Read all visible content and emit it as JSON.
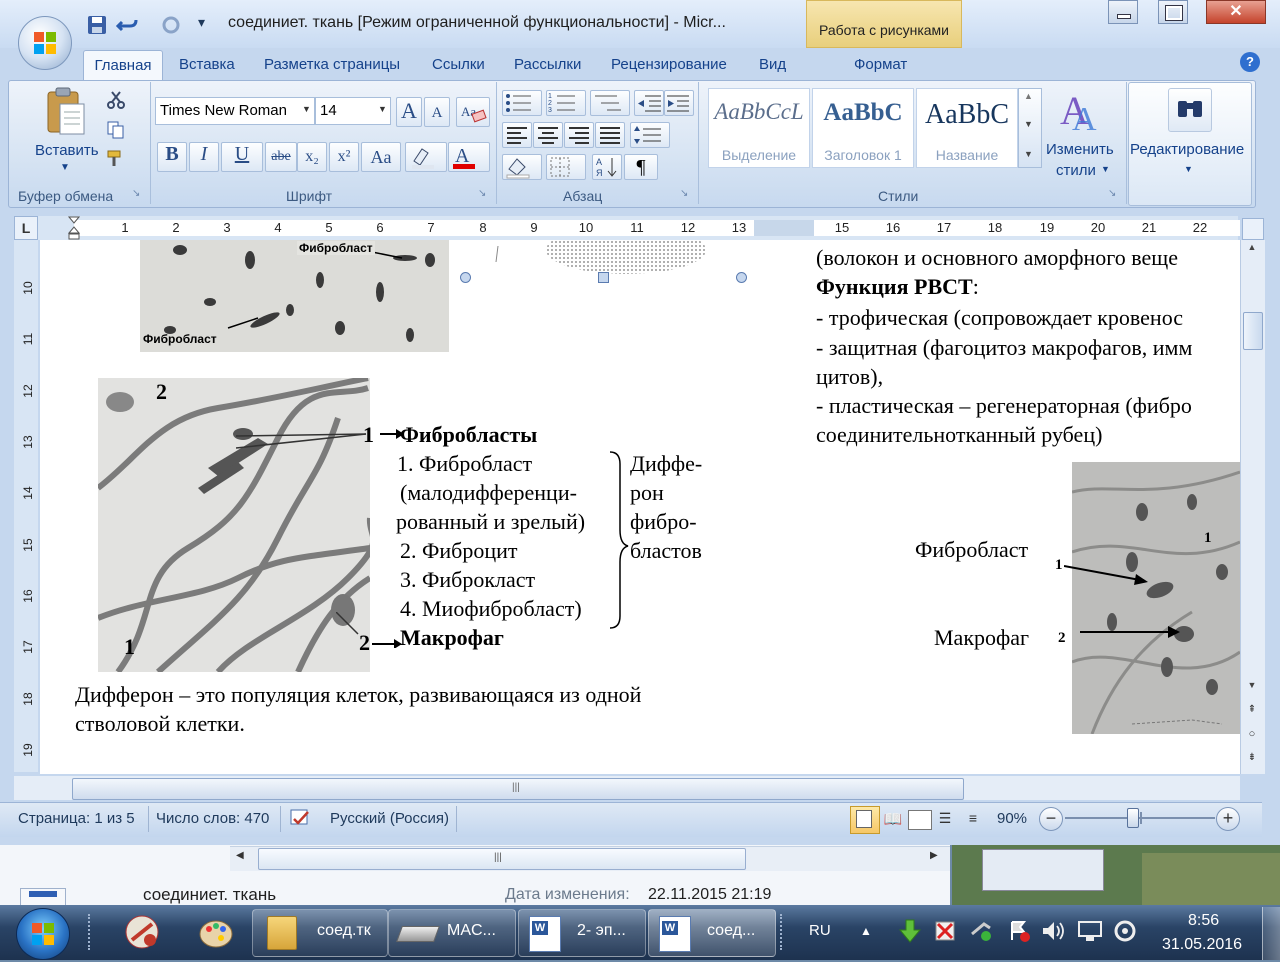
{
  "window": {
    "title": "соединиет. ткань [Режим ограниченной функциональности] - Micr...",
    "context_tab_group": "Работа с рисунками",
    "close_glyph": "✕"
  },
  "ribbon": {
    "tabs": [
      "Главная",
      "Вставка",
      "Разметка страницы",
      "Ссылки",
      "Рассылки",
      "Рецензирование",
      "Вид",
      "Формат"
    ],
    "clipboard": {
      "paste_label": "Вставить",
      "group_label": "Буфер обмена"
    },
    "font": {
      "family": "Times New Roman",
      "size": "14",
      "group_label": "Шрифт",
      "bold": "B",
      "italic": "I",
      "underline": "U",
      "strike": "abe",
      "subscript": "x₂",
      "superscript": "x²",
      "case": "Aa",
      "grow": "A",
      "shrink": "A"
    },
    "paragraph": {
      "group_label": "Абзац",
      "pilcrow": "¶"
    },
    "styles": {
      "group_label": "Стили",
      "items": [
        {
          "preview": "AaBbCcL",
          "name": "Выделение"
        },
        {
          "preview": "AaBbC",
          "name": "Заголовок 1"
        },
        {
          "preview": "AaBbC",
          "name": "Название"
        }
      ],
      "change_styles_line1": "Изменить",
      "change_styles_line2": "стили"
    },
    "editing": {
      "label": "Редактирование"
    }
  },
  "ruler": {
    "numbers": [
      "1",
      "2",
      "3",
      "4",
      "5",
      "6",
      "7",
      "8",
      "9",
      "10",
      "11",
      "12",
      "13",
      "15",
      "16",
      "17",
      "18",
      "19",
      "20",
      "21",
      "22"
    ],
    "vertical_numbers": [
      "10",
      "11",
      "12",
      "13",
      "14",
      "15",
      "16",
      "17",
      "18",
      "19"
    ]
  },
  "document": {
    "photo_label_top": "Фибробласт",
    "photo_label_bottom": "Фибробласт",
    "diagram_number_2_top": "2",
    "diagram_number_1_left": "1",
    "diagram_number_1_arrow": "1",
    "diagram_number_2_arrow": "2",
    "fibroblasts_heading": "Фибробласты",
    "list": [
      "1. Фибробласт",
      "(малодифференци-",
      "рованный и зрелый)",
      "2. Фиброцит",
      "3. Фиброкласт",
      "4. Миофибробласт)"
    ],
    "differon_lines": [
      "Диффе-",
      "рон",
      "фибро-",
      "бластов"
    ],
    "macrophage_heading": "Макрофаг",
    "definition_line1": "Дифферон – это популяция клеток, развивающаяся из одной",
    "definition_line2": "стволовой клетки.",
    "right_col": {
      "line1": "(волокон  и основного аморфного веще",
      "function_heading": "Функция РВСТ",
      "function_colon": ":",
      "item1": "- трофическая (сопровождает кровенос",
      "item2": "- защитная (фагоцитоз макрофагов, имм",
      "item2b": "цитов),",
      "item3": "- пластическая – регенераторная (фибро",
      "item3b": "соединительнотканный рубец)"
    },
    "right_image": {
      "label_fibroblast": "Фибробласт",
      "label_macrophage": "Макрофаг",
      "num1": "1",
      "num2": "2",
      "num1_inner": "1"
    }
  },
  "statusbar": {
    "page": "Страница: 1 из 5",
    "words": "Число слов: 470",
    "language": "Русский (Россия)",
    "zoom": "90%",
    "zoom_level_percent": 90
  },
  "explorer": {
    "file_name": "соединиет. ткань",
    "modified_label": "Дата изменения:",
    "modified_value": "22.11.2015 21:19"
  },
  "taskbar": {
    "buttons": [
      {
        "label": "соед.тк"
      },
      {
        "label": "MAC..."
      },
      {
        "label": "2- эп..."
      },
      {
        "label": "соед..."
      }
    ],
    "lang": "RU",
    "time": "8:56",
    "date": "31.05.2016"
  }
}
